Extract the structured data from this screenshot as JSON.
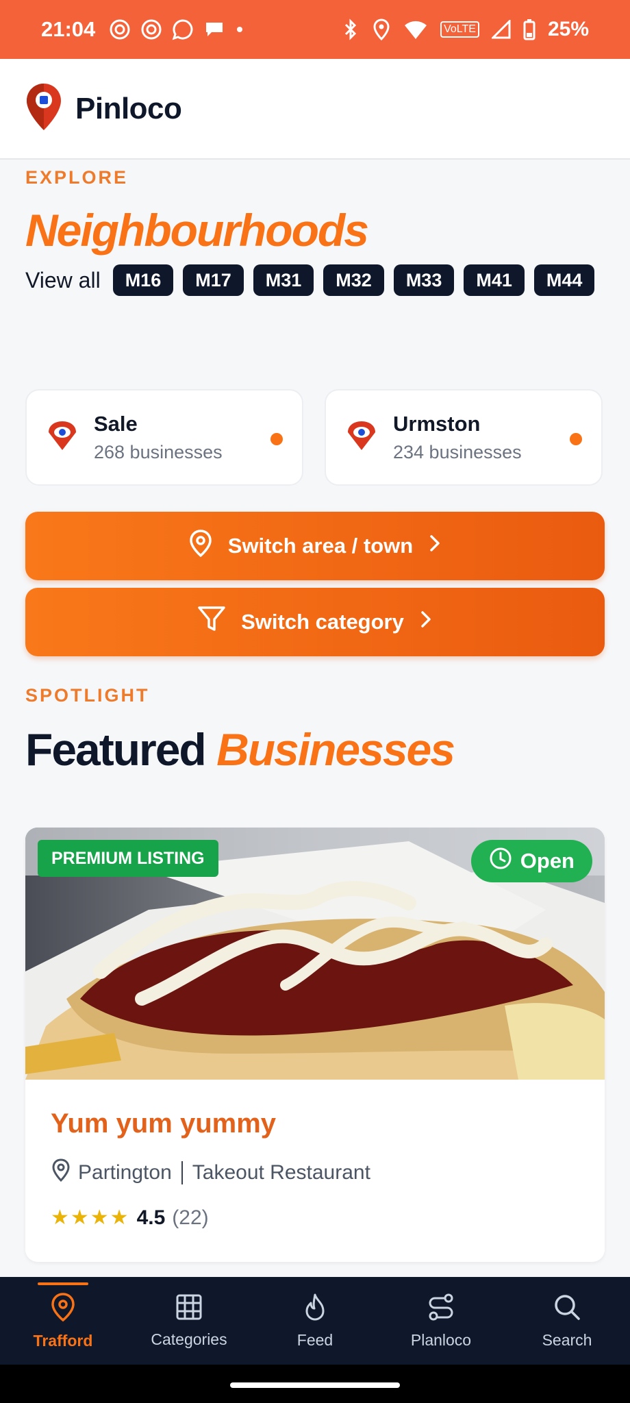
{
  "status_bar": {
    "time": "21:04",
    "battery": "25%",
    "volte": "VoLTE"
  },
  "header": {
    "brand": "Pinloco"
  },
  "explore": {
    "eyebrow": "EXPLORE",
    "title": "Neighbourhoods",
    "view_all": "View all",
    "postcodes": [
      "M16",
      "M17",
      "M31",
      "M32",
      "M33",
      "M41",
      "M44"
    ]
  },
  "areas": [
    {
      "name": "Sale",
      "count": "268 businesses"
    },
    {
      "name": "Urmston",
      "count": "234 businesses"
    }
  ],
  "buttons": {
    "switch_area": "Switch area / town",
    "switch_category": "Switch category"
  },
  "spotlight": {
    "eyebrow": "SPOTLIGHT",
    "title_1": "Featured",
    "title_2": "Businesses"
  },
  "featured": {
    "badge": "PREMIUM LISTING",
    "status": "Open",
    "name": "Yum yum yummy",
    "location": "Partington",
    "category": "Takeout Restaurant",
    "stars": "★★★★",
    "rating": "4.5",
    "reviews": "(22)"
  },
  "nav": {
    "items": [
      {
        "label": "Trafford",
        "icon": "map-pin-icon"
      },
      {
        "label": "Categories",
        "icon": "grid-icon"
      },
      {
        "label": "Feed",
        "icon": "flame-icon"
      },
      {
        "label": "Planloco",
        "icon": "route-icon"
      },
      {
        "label": "Search",
        "icon": "search-icon"
      }
    ]
  },
  "colors": {
    "status_bar": "#f4623a",
    "accent": "#f97316",
    "nav_bg": "#0f172a",
    "open_green": "#22b152",
    "premium_green": "#16a34a"
  }
}
